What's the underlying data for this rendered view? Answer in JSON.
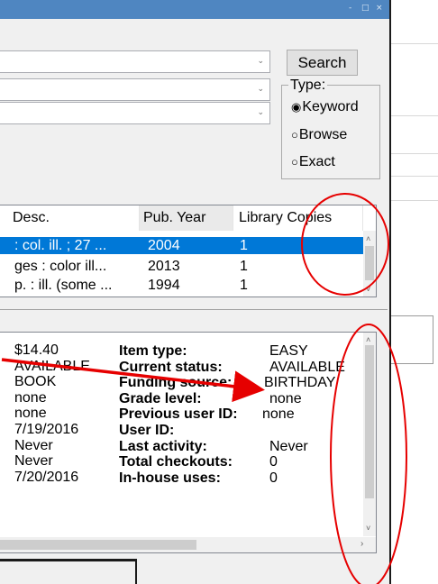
{
  "window": {
    "title_controls": [
      "-",
      "□",
      "×"
    ]
  },
  "search": {
    "button_label": "Search",
    "type_label": "Type:",
    "type_options": [
      {
        "label": "Keyword",
        "selected": true
      },
      {
        "label": "Browse",
        "selected": false
      },
      {
        "label": "Exact",
        "selected": false
      }
    ]
  },
  "results": {
    "columns": [
      "Desc.",
      "Pub. Year",
      "Library Copies"
    ],
    "rows": [
      {
        "desc": ": col. ill. ; 27 ...",
        "year": "2004",
        "copies": "1",
        "selected": true
      },
      {
        "desc": "ges  : color ill...",
        "year": "2013",
        "copies": "1",
        "selected": false
      },
      {
        "desc": "p. : ill. (some ...",
        "year": "1994",
        "copies": "1",
        "selected": false
      }
    ]
  },
  "details": {
    "left_values": [
      "$14.40",
      "AVAILABLE",
      "BOOK",
      "none",
      "none",
      "7/19/2016",
      "Never",
      "Never",
      "7/20/2016"
    ],
    "fields": [
      {
        "label": "Item type:",
        "value": "EASY"
      },
      {
        "label": "Current status:",
        "value": "AVAILABLE"
      },
      {
        "label": "Funding source:",
        "value": "BIRTHDAY"
      },
      {
        "label": "Grade level:",
        "value": "none"
      },
      {
        "label": "Previous user ID:",
        "value": "none"
      },
      {
        "label": "User ID:",
        "value": ""
      },
      {
        "label": "Last activity:",
        "value": "Never"
      },
      {
        "label": "Total checkouts:",
        "value": "0"
      },
      {
        "label": "In-house uses:",
        "value": "0"
      }
    ]
  },
  "colors": {
    "selection": "#0078d7",
    "annotation_red": "#e60000",
    "titlebar": "#4f86c1"
  },
  "icons": [
    "chevron-down-icon",
    "radio-selected-icon",
    "radio-empty-icon",
    "scroll-up-icon",
    "scroll-down-icon",
    "scroll-right-icon"
  ]
}
